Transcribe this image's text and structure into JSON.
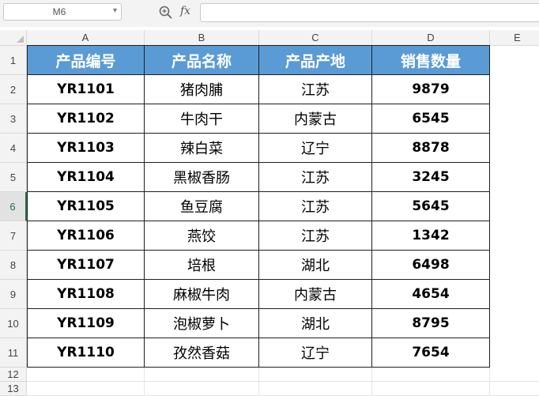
{
  "formula_bar": {
    "name_box": "M6",
    "name_arrow": "▾",
    "fx": "fx",
    "formula": ""
  },
  "columns": [
    "A",
    "B",
    "C",
    "D",
    "E"
  ],
  "rows": [
    "1",
    "2",
    "3",
    "4",
    "5",
    "6",
    "7",
    "8",
    "9",
    "10",
    "11",
    "12",
    "13"
  ],
  "active_row": "6",
  "table": {
    "headers": [
      "产品编号",
      "产品名称",
      "产品产地",
      "销售数量"
    ],
    "rows": [
      [
        "YR1101",
        "猪肉脯",
        "江苏",
        "9879"
      ],
      [
        "YR1102",
        "牛肉干",
        "内蒙古",
        "6545"
      ],
      [
        "YR1103",
        "辣白菜",
        "辽宁",
        "8878"
      ],
      [
        "YR1104",
        "黑椒香肠",
        "江苏",
        "3245"
      ],
      [
        "YR1105",
        "鱼豆腐",
        "江苏",
        "5645"
      ],
      [
        "YR1106",
        "燕饺",
        "江苏",
        "1342"
      ],
      [
        "YR1107",
        "培根",
        "湖北",
        "6498"
      ],
      [
        "YR1108",
        "麻椒牛肉",
        "内蒙古",
        "4654"
      ],
      [
        "YR1109",
        "泡椒萝卜",
        "湖北",
        "8795"
      ],
      [
        "YR1110",
        "孜然香菇",
        "辽宁",
        "7654"
      ]
    ]
  },
  "colors": {
    "header_fill": "#5b9bd5",
    "header_text": "#ffffff",
    "active_accent": "#217346"
  },
  "icons": [
    "zoom-icon",
    "fx-icon",
    "dropdown-arrow-icon"
  ]
}
